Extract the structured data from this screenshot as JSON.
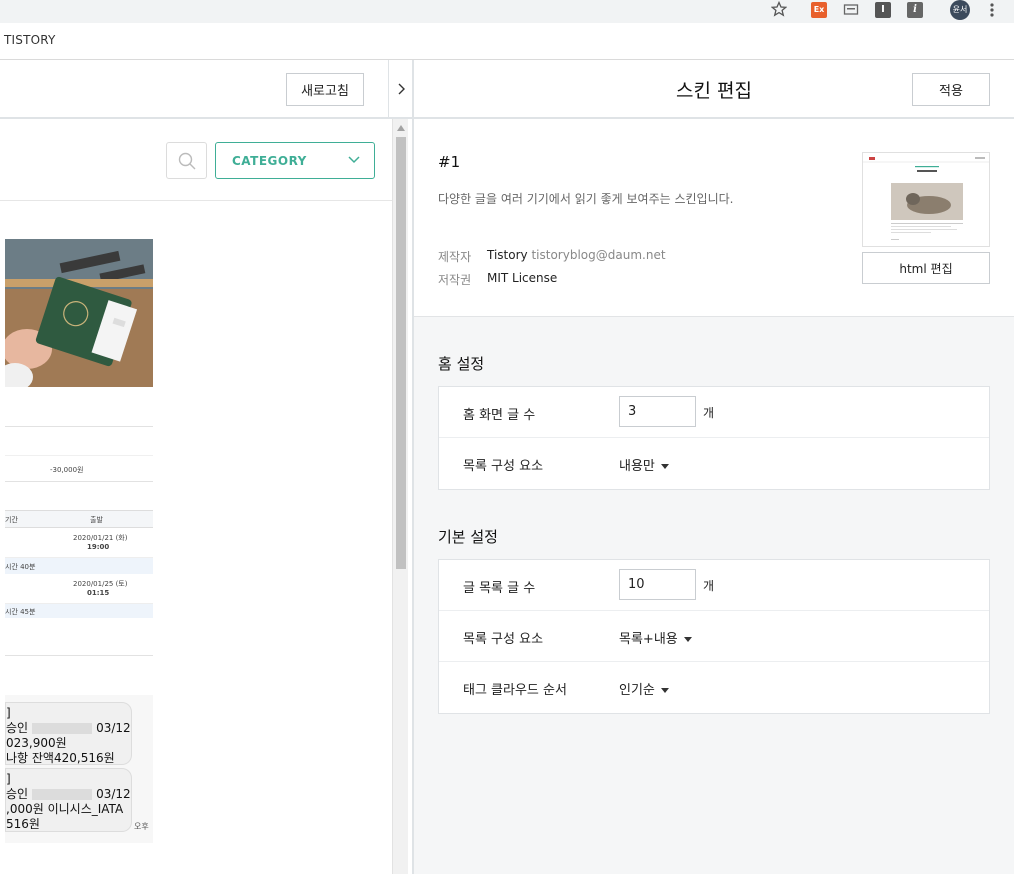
{
  "browser": {
    "tab_title": "TISTORY",
    "profile_label": "윤서",
    "extensions": [
      "star-icon",
      "ext-red-icon",
      "ext-screen-icon",
      "ext-i-icon",
      "ext-info-icon"
    ]
  },
  "preview": {
    "refresh_label": "새로고침",
    "category_label": "CATEGORY",
    "table_amount": "-30,000원",
    "table_header_left": "기간",
    "table_header_right": "출발",
    "rows": [
      {
        "date": "2020/01/21 (화)",
        "time": "19:00",
        "note": "시간 40분"
      },
      {
        "date": "2020/01/25 (토)",
        "time": "01:15",
        "note": "시간 45분"
      }
    ],
    "messages": [
      {
        "l1": "]",
        "l2a": "승인",
        "l2b": "03/12",
        "l3": "023,900원",
        "l4": "나항 잔액420,516원"
      },
      {
        "l1": "]",
        "l2a": "승인",
        "l2b": "03/12",
        "l3": ",000원 이니시스_IATA",
        "l4": "516원"
      }
    ],
    "message_time": "오후"
  },
  "editor": {
    "title": "스킨 편집",
    "apply_label": "적용",
    "skin": {
      "number": "#1",
      "description": "다양한 글을 여러 기기에서 읽기 좋게 보여주는 스킨입니다.",
      "maker_label": "제작자",
      "maker_name": "Tistory",
      "maker_email": "tistoryblog@daum.net",
      "license_label": "저작권",
      "license_value": "MIT License",
      "html_edit_label": "html 편집"
    },
    "home_settings": {
      "title": "홈 설정",
      "post_count_label": "홈 화면 글 수",
      "post_count_value": "3",
      "post_count_unit": "개",
      "list_component_label": "목록 구성 요소",
      "list_component_value": "내용만"
    },
    "basic_settings": {
      "title": "기본 설정",
      "list_count_label": "글 목록 글 수",
      "list_count_value": "10",
      "list_count_unit": "개",
      "list_component_label": "목록 구성 요소",
      "list_component_value": "목록+내용",
      "tag_cloud_label": "태그 클라우드 순서",
      "tag_cloud_value": "인기순"
    }
  }
}
